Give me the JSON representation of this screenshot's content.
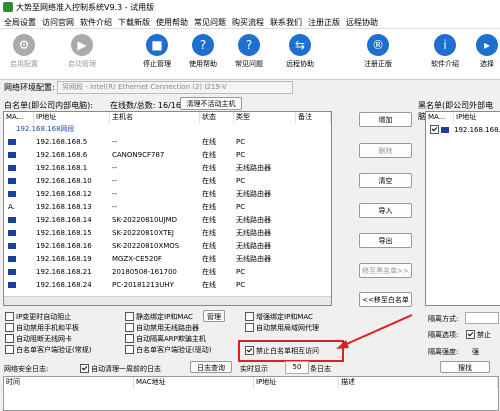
{
  "title": {
    "text": "大势至网络准入控制系统V9.3 - 试用版"
  },
  "menu": [
    "全局设置",
    "访问官网",
    "软件介绍",
    "下载新版",
    "使用帮助",
    "常见问题",
    "购买流程",
    "联系我们",
    "注册正版",
    "远程协助"
  ],
  "toolbar": [
    {
      "label": "启用配置",
      "icon": "gear-icon",
      "disabled": true
    },
    {
      "label": "启动管理",
      "icon": "play-icon",
      "disabled": true
    },
    {
      "label": "停止管理",
      "icon": "stop-icon"
    },
    {
      "label": "使用帮助",
      "icon": "help-icon"
    },
    {
      "label": "常见问题",
      "icon": "question-icon"
    },
    {
      "label": "远程协助",
      "icon": "remote-icon"
    },
    {
      "label": "注册正版",
      "icon": "register-icon"
    },
    {
      "label": "软件介绍",
      "icon": "info-icon"
    },
    {
      "label": "选择",
      "icon": "select-icon"
    }
  ],
  "net": {
    "label": "网络环境配置:",
    "value": "另网段 - Intel(R) Ethernet Connection (2) I219-V"
  },
  "whitelist": {
    "title": "白名单(即公司内部电脑):",
    "online": "在线数/总数: 16/16",
    "clear_button": "清理不活动主机",
    "columns": [
      "MA...",
      "IP地址",
      "主机名",
      "状态",
      "类型",
      "备注"
    ],
    "group": "192.168.168网段",
    "rows": [
      {
        "mark": "",
        "ip": "192.168.168.5",
        "host": "--",
        "status": "在线",
        "type": "PC",
        "note": ""
      },
      {
        "mark": "",
        "ip": "192.168.168.6",
        "host": "CANON9CF787",
        "status": "在线",
        "type": "PC",
        "note": ""
      },
      {
        "mark": "",
        "ip": "192.168.168.1",
        "host": "--",
        "status": "在线",
        "type": "无线路由器",
        "note": ""
      },
      {
        "mark": "",
        "ip": "192.168.168.10",
        "host": "--",
        "status": "在线",
        "type": "PC",
        "note": ""
      },
      {
        "mark": "",
        "ip": "192.168.168.12",
        "host": "--",
        "status": "在线",
        "type": "无线路由器",
        "note": ""
      },
      {
        "mark": "A.",
        "ip": "192.168.168.13",
        "host": "--",
        "status": "在线",
        "type": "PC",
        "note": ""
      },
      {
        "mark": "",
        "ip": "192.168.168.14",
        "host": "SK-20220810UJMD",
        "status": "在线",
        "type": "无线路由器",
        "note": ""
      },
      {
        "mark": "",
        "ip": "192.168.168.15",
        "host": "SK-20220810XTEJ",
        "status": "在线",
        "type": "无线路由器",
        "note": ""
      },
      {
        "mark": "",
        "ip": "192.168.168.16",
        "host": "SK-20220810XMOS",
        "status": "在线",
        "type": "无线路由器",
        "note": ""
      },
      {
        "mark": "",
        "ip": "192.168.168.19",
        "host": "MGZX-CE520F",
        "status": "在线",
        "type": "无线路由器",
        "note": ""
      },
      {
        "mark": "",
        "ip": "192.168.168.21",
        "host": "20180508-161700",
        "status": "在线",
        "type": "PC",
        "note": ""
      },
      {
        "mark": "",
        "ip": "192.168.168.24",
        "host": "PC-20181213UHY",
        "status": "在线",
        "type": "PC",
        "note": ""
      }
    ]
  },
  "buttons": {
    "add": "增加",
    "delete": "删除",
    "clear": "清空",
    "import": "导入",
    "export": "导出",
    "move_black": "移至黑名单>>",
    "move_white": "<<移至白名单"
  },
  "blacklist": {
    "title": "黑名单(即公司外部电脑",
    "columns": [
      "MA...",
      "IP地址"
    ],
    "rows": [
      {
        "ip": "192.168.168.1"
      }
    ]
  },
  "options": [
    {
      "label": "IP变更时自动阻止",
      "checked": false
    },
    {
      "label": "自动禁用手机和平板",
      "checked": false
    },
    {
      "label": "自动阻断无线网卡",
      "checked": false
    },
    {
      "label": "白名单客户端验证(常规)",
      "checked": false
    },
    {
      "label": "静态绑定IP和MAC",
      "checked": false
    },
    {
      "label": "自动禁用无线路由器",
      "checked": false
    },
    {
      "label": "自动隔离ARP欺骗主机",
      "checked": false
    },
    {
      "label": "白名单客户端验证(驱动)",
      "checked": false
    },
    {
      "label": "增强绑定IP和MAC",
      "checked": false
    },
    {
      "label": "自动禁用局域网代理",
      "checked": false
    },
    {
      "label": "禁止白名单相互访问",
      "checked": true
    }
  ],
  "manage_button": "管理",
  "isolation": {
    "mode": "隔离方式:",
    "choice": "隔离选项:",
    "strength": "隔离强度:",
    "opt": "禁止",
    "strong": "强"
  },
  "log": {
    "title": "网络安全日志:",
    "auto_clear": "自动清理一周前的日志",
    "query": "日志查询",
    "realtime": "实时显示",
    "count": "50",
    "unit": "条日志",
    "search": "搜找",
    "columns": [
      "时间",
      "MAC地址",
      "IP地址",
      "描述"
    ]
  }
}
